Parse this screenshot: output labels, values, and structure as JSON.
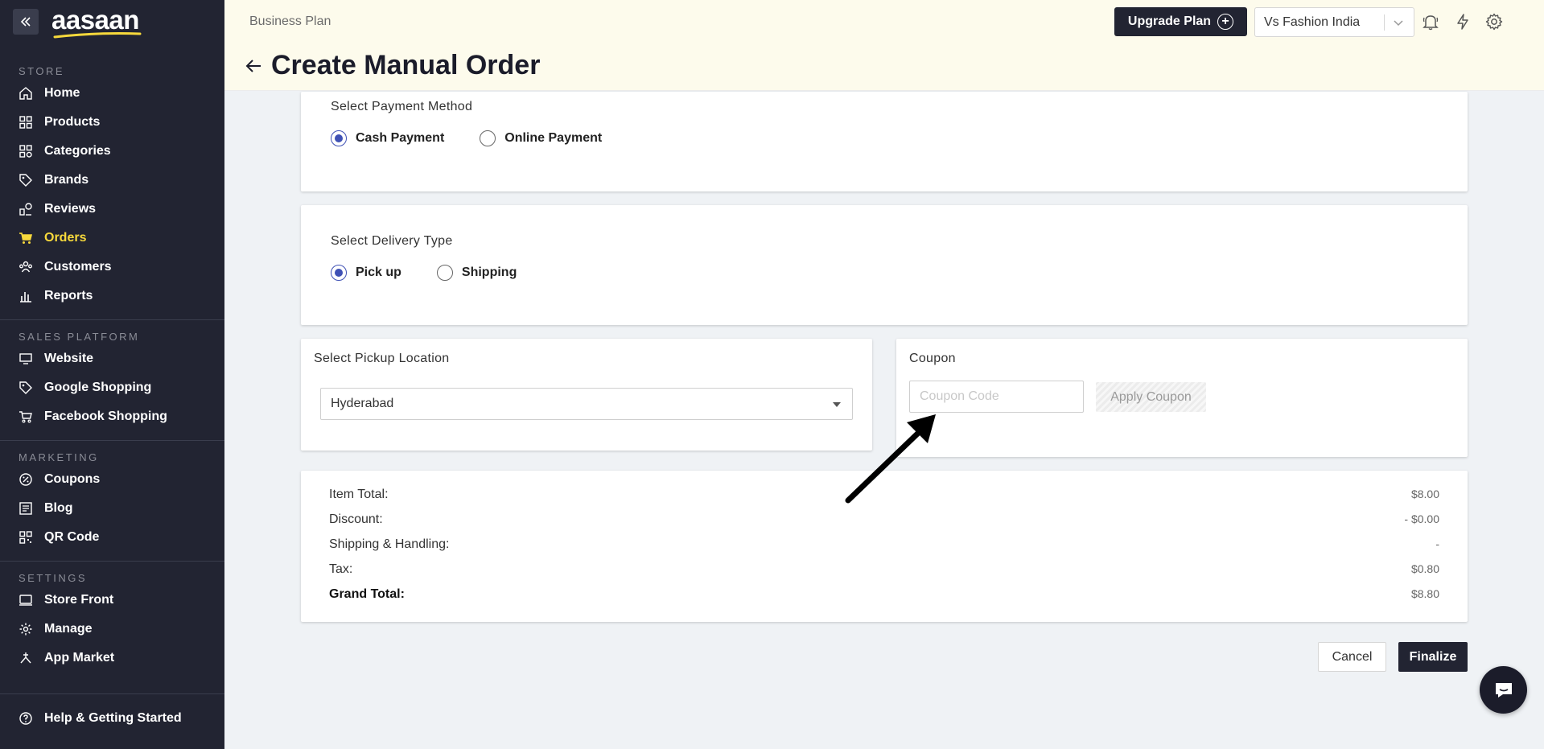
{
  "brand": {
    "logo_text": "aasaan"
  },
  "sidebar": {
    "sections": [
      {
        "title": "STORE",
        "items": [
          {
            "label": "Home",
            "icon": "home-icon"
          },
          {
            "label": "Products",
            "icon": "products-icon"
          },
          {
            "label": "Categories",
            "icon": "categories-icon"
          },
          {
            "label": "Brands",
            "icon": "tag-icon"
          },
          {
            "label": "Reviews",
            "icon": "reviews-icon"
          },
          {
            "label": "Orders",
            "icon": "cart-icon",
            "active": true
          },
          {
            "label": "Customers",
            "icon": "customers-icon"
          },
          {
            "label": "Reports",
            "icon": "reports-icon"
          }
        ]
      },
      {
        "title": "SALES PLATFORM",
        "items": [
          {
            "label": "Website",
            "icon": "monitor-icon"
          },
          {
            "label": "Google Shopping",
            "icon": "tag-icon"
          },
          {
            "label": "Facebook Shopping",
            "icon": "cart-outline-icon"
          }
        ]
      },
      {
        "title": "MARKETING",
        "items": [
          {
            "label": "Coupons",
            "icon": "coupon-icon"
          },
          {
            "label": "Blog",
            "icon": "blog-icon"
          },
          {
            "label": "QR Code",
            "icon": "qr-icon"
          }
        ]
      },
      {
        "title": "SETTINGS",
        "items": [
          {
            "label": "Store Front",
            "icon": "storefront-icon"
          },
          {
            "label": "Manage",
            "icon": "gear-icon"
          },
          {
            "label": "App Market",
            "icon": "app-market-icon"
          }
        ]
      }
    ],
    "help": {
      "label": "Help & Getting Started",
      "icon": "help-icon"
    }
  },
  "header": {
    "plan_label": "Business Plan",
    "upgrade_label": "Upgrade Plan",
    "store_name": "Vs Fashion India",
    "page_title": "Create Manual Order"
  },
  "payment": {
    "title": "Select Payment Method",
    "options": [
      "Cash Payment",
      "Online Payment"
    ],
    "selected": "Cash Payment"
  },
  "delivery": {
    "title": "Select Delivery Type",
    "options": [
      "Pick up",
      "Shipping"
    ],
    "selected": "Pick up"
  },
  "pickup": {
    "title": "Select Pickup Location",
    "value": "Hyderabad"
  },
  "coupon": {
    "title": "Coupon",
    "placeholder": "Coupon Code",
    "apply_label": "Apply Coupon"
  },
  "summary": {
    "rows": [
      {
        "label": "Item Total:",
        "value": "$8.00"
      },
      {
        "label": "Discount:",
        "value": "- $0.00"
      },
      {
        "label": "Shipping & Handling:",
        "value": "-"
      },
      {
        "label": "Tax:",
        "value": "$0.80"
      },
      {
        "label": "Grand Total:",
        "value": "$8.80"
      }
    ]
  },
  "actions": {
    "cancel": "Cancel",
    "finalize": "Finalize"
  },
  "colors": {
    "sidebar_bg": "#222432",
    "active_nav": "#f7d93c",
    "header_bg": "#fdfbec",
    "radio_accent": "#3f51b5",
    "page_bg": "#eff2f5"
  }
}
